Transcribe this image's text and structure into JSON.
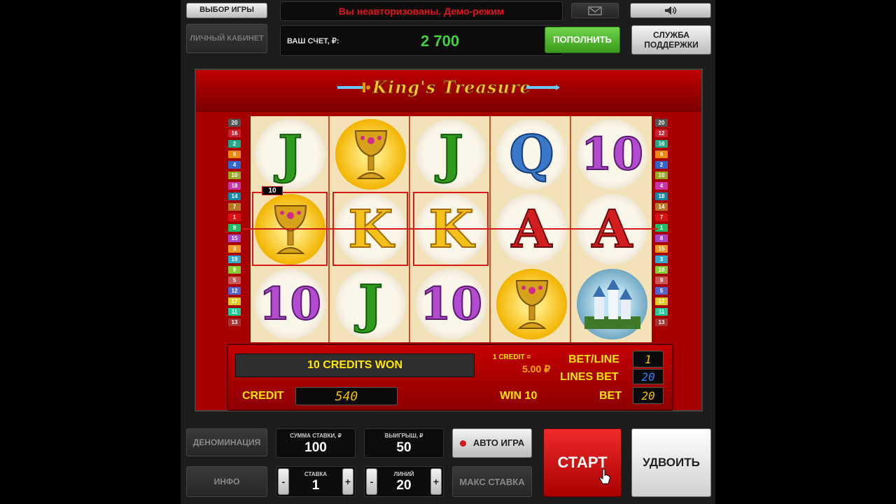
{
  "top_bar": {
    "select_game": "ВЫБОР ИГРЫ",
    "cabinet": "ЛИЧНЫЙ КАБИНЕТ",
    "status_message": "Вы неавторизованы. Демо-режим",
    "account_label": "ВАШ СЧЕТ, ₽:",
    "balance": "2 700",
    "deposit": "ПОПОЛНИТЬ",
    "support_line1": "СЛУЖБА",
    "support_line2": "ПОДДЕРЖКИ",
    "mail_icon": "envelope-icon",
    "sound_icon": "speaker-icon"
  },
  "game": {
    "title": "King's Treasure",
    "reels": [
      [
        "J",
        "goblet",
        "10"
      ],
      [
        "goblet",
        "K",
        "J"
      ],
      [
        "J",
        "K",
        "10"
      ],
      [
        "Q",
        "A",
        "goblet"
      ],
      [
        "10",
        "A",
        "castle"
      ]
    ],
    "win_line_badge": "10",
    "left_line_numbers": [
      "20",
      "16",
      "2",
      "6",
      "4",
      "10",
      "18",
      "14",
      "7",
      "1",
      "8",
      "15",
      "3",
      "19",
      "9",
      "5",
      "12",
      "17",
      "11",
      "13"
    ],
    "right_line_numbers": [
      "20",
      "12",
      "16",
      "6",
      "2",
      "10",
      "4",
      "18",
      "14",
      "7",
      "1",
      "8",
      "15",
      "3",
      "19",
      "9",
      "5",
      "17",
      "11",
      "13"
    ]
  },
  "info_panel": {
    "message": "10 CREDITS WON",
    "credit_label": "CREDIT",
    "credit_value": "540",
    "one_credit_label": "1 CREDIT =",
    "one_credit_value": "5.00 ₽",
    "win_text": "WIN 10",
    "bet_line_label": "BET/LINE",
    "bet_line_value": "1",
    "lines_bet_label": "LINES BET",
    "lines_bet_value": "20",
    "bet_label": "BET",
    "bet_value": "20"
  },
  "bottom_bar": {
    "denomination": "ДЕНОМИНАЦИЯ",
    "info": "ИНФО",
    "stake_sum_label": "СУММА СТАВКИ, ₽",
    "stake_sum_value": "100",
    "winnings_label": "ВЫИГРЫШ, ₽",
    "winnings_value": "50",
    "auto_play": "АВТО ИГРА",
    "max_bet": "МАКС СТАВКА",
    "stake_label": "СТАВКА",
    "stake_value": "1",
    "lines_label": "ЛИНИЙ",
    "lines_value": "20",
    "minus": "-",
    "plus": "+",
    "start": "СТАРТ",
    "double": "УДВОИТЬ"
  },
  "colors": {
    "accent_red": "#d41a1a",
    "balance_green": "#3fd23f",
    "deposit_green": "#4cb82c",
    "info_yellow": "#ffe600"
  }
}
